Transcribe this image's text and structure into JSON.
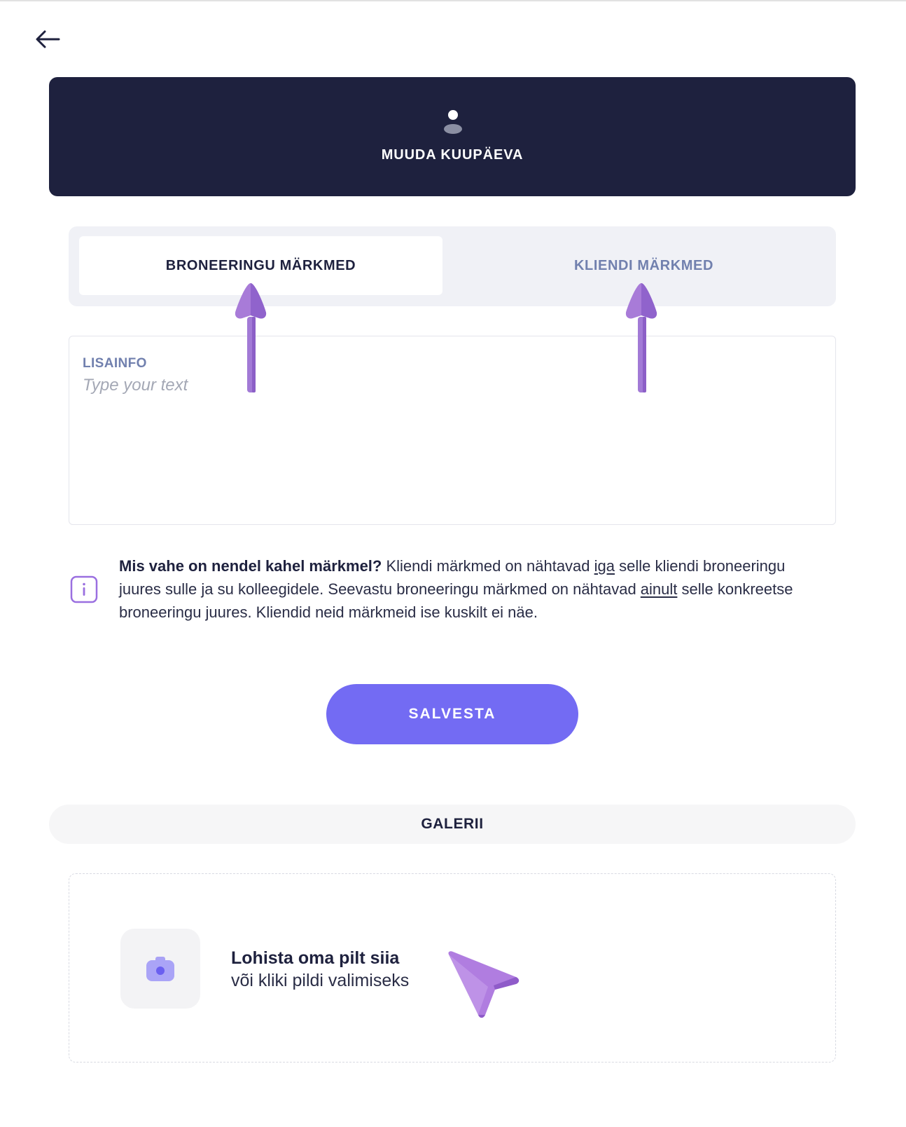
{
  "header": {
    "back_icon": "arrow-left-icon",
    "avatar_icon": "user-icon",
    "title": "MUUDA KUUPÄEVA"
  },
  "tabs": [
    {
      "label": "BRONEERINGU MÄRKMED",
      "active": true
    },
    {
      "label": "KLIENDI MÄRKMED",
      "active": false
    }
  ],
  "notes": {
    "label": "LISAINFO",
    "placeholder": "Type your text",
    "value": ""
  },
  "info": {
    "icon": "info-icon",
    "question": "Mis vahe on nendel kahel märkmel?",
    "text_1": " Kliendi märkmed on nähtavad ",
    "underline_1": "iga",
    "text_2": " selle kliendi broneeringu juures sulle ja su kolleegidele. Seevastu broneeringu märkmed on nähtavad ",
    "underline_2": "ainult",
    "text_3": " selle konkreetse broneeringu juures. Kliendid neid märkmeid ise kuskilt ei näe."
  },
  "save_button": "SALVESTA",
  "gallery": {
    "title": "GALERII",
    "camera_icon": "camera-icon",
    "drop_title": "Lohista oma pilt siia",
    "drop_subtitle": "või kliki pildi valimiseks"
  },
  "colors": {
    "header_bg": "#1e213e",
    "accent": "#736bf3",
    "muted_blue": "#7180ae",
    "annotation_purple": "#a87bd8"
  }
}
